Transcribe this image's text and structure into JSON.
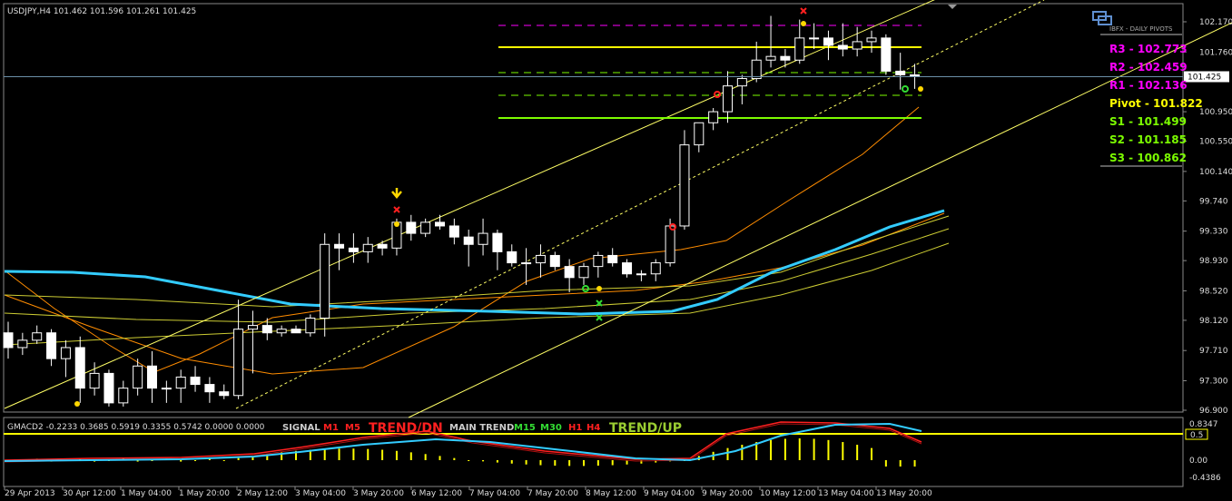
{
  "header": {
    "symbol_info": "USDJPY,H4  101.462 101.596 101.261 101.425"
  },
  "pivot_panel": {
    "title": "IBFX - DAILY PIVOTS",
    "levels": [
      {
        "label": "R3 - 102.773",
        "color": "#ff00ff"
      },
      {
        "label": "R2 - 102.459",
        "color": "#ff00ff"
      },
      {
        "label": "R1 - 102.136",
        "color": "#ff00ff"
      },
      {
        "label": "Pivot - 101.822",
        "color": "#ffff00"
      },
      {
        "label": "S1 - 101.499",
        "color": "#7cfc00"
      },
      {
        "label": "S2 - 101.185",
        "color": "#7cfc00"
      },
      {
        "label": "S3 - 100.862",
        "color": "#7cfc00"
      }
    ]
  },
  "indicator": {
    "label": "GMACD2 -0.2233 0.3685 0.5919 0.3355 0.5742 0.0000 0.0000",
    "signal": "SIGNAL",
    "m1": "M1",
    "m5": "M5",
    "trend_dn": "TREND/DN",
    "main_trend": "MAIN TREND",
    "m15": "M15",
    "m30": "M30",
    "h1": "H1",
    "h4": "H4",
    "trend_up": "TREND/UP",
    "y_ticks": [
      "0.8347",
      "0.5",
      "0.00",
      "-0.4386"
    ]
  },
  "colors": {
    "background": "#000000",
    "candle_border": "#ffffff",
    "bull_body": "#000000",
    "bear_body": "#ffffff",
    "trend_line": "#ffff66",
    "cyan_ma": "#33ccff",
    "orange_band": "#ff8c00",
    "yellow_band": "#cccc33",
    "macd_hist": "#ffff00",
    "macd_red": "#ff2020",
    "macd_cyan": "#33ccff"
  },
  "chart_data": {
    "type": "candlestick",
    "symbol": "USDJPY",
    "timeframe": "H4",
    "ylim": [
      96.9,
      102.4
    ],
    "y_ticks": [
      102.17,
      101.76,
      101.425,
      100.95,
      100.55,
      100.14,
      99.74,
      99.33,
      98.93,
      98.52,
      98.12,
      97.71,
      97.3,
      96.9
    ],
    "current_price": "101.425",
    "x_labels": [
      "29 Apr 2013",
      "30 Apr 12:00",
      "1 May 04:00",
      "1 May 20:00",
      "2 May 12:00",
      "3 May 04:00",
      "3 May 20:00",
      "6 May 12:00",
      "7 May 04:00",
      "7 May 20:00",
      "8 May 12:00",
      "9 May 04:00",
      "9 May 20:00",
      "10 May 12:00",
      "13 May 04:00",
      "13 May 20:00"
    ],
    "pivots": {
      "R3": 102.773,
      "R2": 102.459,
      "R1": 102.136,
      "Pivot": 101.822,
      "S1": 101.499,
      "S2": 101.185,
      "S3": 100.862
    },
    "candles": [
      [
        97.95,
        98.1,
        97.6,
        97.75
      ],
      [
        97.75,
        97.95,
        97.65,
        97.85
      ],
      [
        97.85,
        98.05,
        97.8,
        97.95
      ],
      [
        97.95,
        98.0,
        97.5,
        97.6
      ],
      [
        97.6,
        97.85,
        97.35,
        97.75
      ],
      [
        97.75,
        97.9,
        97.0,
        97.2
      ],
      [
        97.2,
        97.55,
        97.1,
        97.4
      ],
      [
        97.4,
        97.45,
        96.95,
        97.0
      ],
      [
        97.0,
        97.3,
        96.95,
        97.2
      ],
      [
        97.2,
        97.6,
        97.1,
        97.5
      ],
      [
        97.5,
        97.7,
        97.0,
        97.2
      ],
      [
        97.2,
        97.3,
        97.0,
        97.2
      ],
      [
        97.2,
        97.45,
        97.0,
        97.35
      ],
      [
        97.35,
        97.5,
        97.15,
        97.25
      ],
      [
        97.25,
        97.35,
        97.0,
        97.15
      ],
      [
        97.15,
        97.25,
        97.05,
        97.1
      ],
      [
        97.1,
        98.4,
        97.05,
        98.0
      ],
      [
        98.0,
        98.25,
        97.4,
        98.05
      ],
      [
        98.05,
        98.15,
        97.85,
        97.95
      ],
      [
        97.95,
        98.05,
        97.9,
        98.0
      ],
      [
        98.0,
        98.05,
        97.95,
        97.95
      ],
      [
        97.95,
        98.2,
        97.9,
        98.15
      ],
      [
        98.15,
        99.3,
        97.9,
        99.15
      ],
      [
        99.15,
        99.3,
        98.8,
        99.1
      ],
      [
        99.1,
        99.3,
        98.9,
        99.05
      ],
      [
        99.05,
        99.25,
        98.9,
        99.15
      ],
      [
        99.15,
        99.2,
        99.0,
        99.1
      ],
      [
        99.1,
        99.5,
        99.0,
        99.45
      ],
      [
        99.45,
        99.55,
        99.2,
        99.3
      ],
      [
        99.3,
        99.5,
        99.25,
        99.45
      ],
      [
        99.45,
        99.55,
        99.35,
        99.4
      ],
      [
        99.4,
        99.5,
        99.15,
        99.25
      ],
      [
        99.25,
        99.35,
        98.85,
        99.15
      ],
      [
        99.15,
        99.5,
        99.0,
        99.3
      ],
      [
        99.3,
        99.35,
        98.8,
        99.05
      ],
      [
        99.05,
        99.15,
        98.85,
        98.9
      ],
      [
        98.9,
        99.1,
        98.6,
        98.9
      ],
      [
        98.9,
        99.15,
        98.7,
        99.0
      ],
      [
        99.0,
        99.05,
        98.8,
        98.85
      ],
      [
        98.85,
        98.95,
        98.5,
        98.7
      ],
      [
        98.7,
        98.9,
        98.6,
        98.85
      ],
      [
        98.85,
        99.05,
        98.7,
        99.0
      ],
      [
        99.0,
        99.1,
        98.85,
        98.9
      ],
      [
        98.9,
        98.95,
        98.7,
        98.75
      ],
      [
        98.75,
        98.8,
        98.65,
        98.75
      ],
      [
        98.75,
        98.95,
        98.65,
        98.9
      ],
      [
        98.9,
        99.5,
        98.85,
        99.4
      ],
      [
        99.4,
        100.7,
        99.35,
        100.5
      ],
      [
        100.5,
        100.8,
        100.4,
        100.8
      ],
      [
        100.8,
        101.0,
        100.7,
        100.95
      ],
      [
        100.95,
        101.5,
        100.8,
        101.3
      ],
      [
        101.3,
        101.45,
        101.05,
        101.4
      ],
      [
        101.4,
        101.9,
        101.35,
        101.65
      ],
      [
        101.65,
        102.25,
        101.55,
        101.7
      ],
      [
        101.7,
        101.8,
        101.55,
        101.65
      ],
      [
        101.65,
        102.2,
        101.6,
        101.95
      ],
      [
        101.95,
        102.15,
        101.8,
        101.95
      ],
      [
        101.95,
        102.05,
        101.65,
        101.85
      ],
      [
        101.85,
        102.15,
        101.7,
        101.8
      ],
      [
        101.8,
        102.1,
        101.7,
        101.9
      ],
      [
        101.9,
        102.05,
        101.75,
        101.95
      ],
      [
        101.95,
        102.0,
        101.45,
        101.5
      ],
      [
        101.5,
        101.75,
        101.25,
        101.45
      ],
      [
        101.45,
        101.6,
        101.26,
        101.425
      ]
    ]
  }
}
